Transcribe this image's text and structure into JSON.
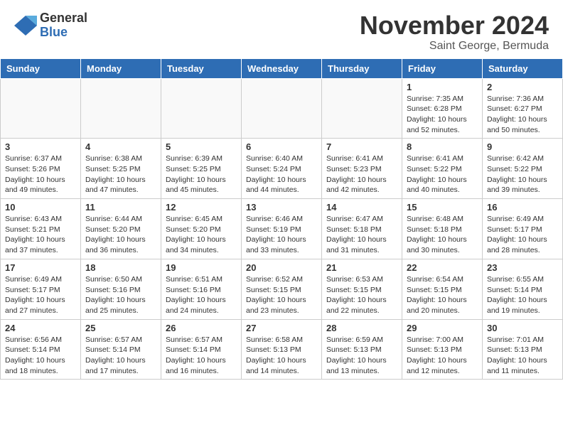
{
  "header": {
    "logo_general": "General",
    "logo_blue": "Blue",
    "month_title": "November 2024",
    "subtitle": "Saint George, Bermuda"
  },
  "weekdays": [
    "Sunday",
    "Monday",
    "Tuesday",
    "Wednesday",
    "Thursday",
    "Friday",
    "Saturday"
  ],
  "weeks": [
    [
      {
        "day": "",
        "info": ""
      },
      {
        "day": "",
        "info": ""
      },
      {
        "day": "",
        "info": ""
      },
      {
        "day": "",
        "info": ""
      },
      {
        "day": "",
        "info": ""
      },
      {
        "day": "1",
        "info": "Sunrise: 7:35 AM\nSunset: 6:28 PM\nDaylight: 10 hours\nand 52 minutes."
      },
      {
        "day": "2",
        "info": "Sunrise: 7:36 AM\nSunset: 6:27 PM\nDaylight: 10 hours\nand 50 minutes."
      }
    ],
    [
      {
        "day": "3",
        "info": "Sunrise: 6:37 AM\nSunset: 5:26 PM\nDaylight: 10 hours\nand 49 minutes."
      },
      {
        "day": "4",
        "info": "Sunrise: 6:38 AM\nSunset: 5:25 PM\nDaylight: 10 hours\nand 47 minutes."
      },
      {
        "day": "5",
        "info": "Sunrise: 6:39 AM\nSunset: 5:25 PM\nDaylight: 10 hours\nand 45 minutes."
      },
      {
        "day": "6",
        "info": "Sunrise: 6:40 AM\nSunset: 5:24 PM\nDaylight: 10 hours\nand 44 minutes."
      },
      {
        "day": "7",
        "info": "Sunrise: 6:41 AM\nSunset: 5:23 PM\nDaylight: 10 hours\nand 42 minutes."
      },
      {
        "day": "8",
        "info": "Sunrise: 6:41 AM\nSunset: 5:22 PM\nDaylight: 10 hours\nand 40 minutes."
      },
      {
        "day": "9",
        "info": "Sunrise: 6:42 AM\nSunset: 5:22 PM\nDaylight: 10 hours\nand 39 minutes."
      }
    ],
    [
      {
        "day": "10",
        "info": "Sunrise: 6:43 AM\nSunset: 5:21 PM\nDaylight: 10 hours\nand 37 minutes."
      },
      {
        "day": "11",
        "info": "Sunrise: 6:44 AM\nSunset: 5:20 PM\nDaylight: 10 hours\nand 36 minutes."
      },
      {
        "day": "12",
        "info": "Sunrise: 6:45 AM\nSunset: 5:20 PM\nDaylight: 10 hours\nand 34 minutes."
      },
      {
        "day": "13",
        "info": "Sunrise: 6:46 AM\nSunset: 5:19 PM\nDaylight: 10 hours\nand 33 minutes."
      },
      {
        "day": "14",
        "info": "Sunrise: 6:47 AM\nSunset: 5:18 PM\nDaylight: 10 hours\nand 31 minutes."
      },
      {
        "day": "15",
        "info": "Sunrise: 6:48 AM\nSunset: 5:18 PM\nDaylight: 10 hours\nand 30 minutes."
      },
      {
        "day": "16",
        "info": "Sunrise: 6:49 AM\nSunset: 5:17 PM\nDaylight: 10 hours\nand 28 minutes."
      }
    ],
    [
      {
        "day": "17",
        "info": "Sunrise: 6:49 AM\nSunset: 5:17 PM\nDaylight: 10 hours\nand 27 minutes."
      },
      {
        "day": "18",
        "info": "Sunrise: 6:50 AM\nSunset: 5:16 PM\nDaylight: 10 hours\nand 25 minutes."
      },
      {
        "day": "19",
        "info": "Sunrise: 6:51 AM\nSunset: 5:16 PM\nDaylight: 10 hours\nand 24 minutes."
      },
      {
        "day": "20",
        "info": "Sunrise: 6:52 AM\nSunset: 5:15 PM\nDaylight: 10 hours\nand 23 minutes."
      },
      {
        "day": "21",
        "info": "Sunrise: 6:53 AM\nSunset: 5:15 PM\nDaylight: 10 hours\nand 22 minutes."
      },
      {
        "day": "22",
        "info": "Sunrise: 6:54 AM\nSunset: 5:15 PM\nDaylight: 10 hours\nand 20 minutes."
      },
      {
        "day": "23",
        "info": "Sunrise: 6:55 AM\nSunset: 5:14 PM\nDaylight: 10 hours\nand 19 minutes."
      }
    ],
    [
      {
        "day": "24",
        "info": "Sunrise: 6:56 AM\nSunset: 5:14 PM\nDaylight: 10 hours\nand 18 minutes."
      },
      {
        "day": "25",
        "info": "Sunrise: 6:57 AM\nSunset: 5:14 PM\nDaylight: 10 hours\nand 17 minutes."
      },
      {
        "day": "26",
        "info": "Sunrise: 6:57 AM\nSunset: 5:14 PM\nDaylight: 10 hours\nand 16 minutes."
      },
      {
        "day": "27",
        "info": "Sunrise: 6:58 AM\nSunset: 5:13 PM\nDaylight: 10 hours\nand 14 minutes."
      },
      {
        "day": "28",
        "info": "Sunrise: 6:59 AM\nSunset: 5:13 PM\nDaylight: 10 hours\nand 13 minutes."
      },
      {
        "day": "29",
        "info": "Sunrise: 7:00 AM\nSunset: 5:13 PM\nDaylight: 10 hours\nand 12 minutes."
      },
      {
        "day": "30",
        "info": "Sunrise: 7:01 AM\nSunset: 5:13 PM\nDaylight: 10 hours\nand 11 minutes."
      }
    ]
  ]
}
